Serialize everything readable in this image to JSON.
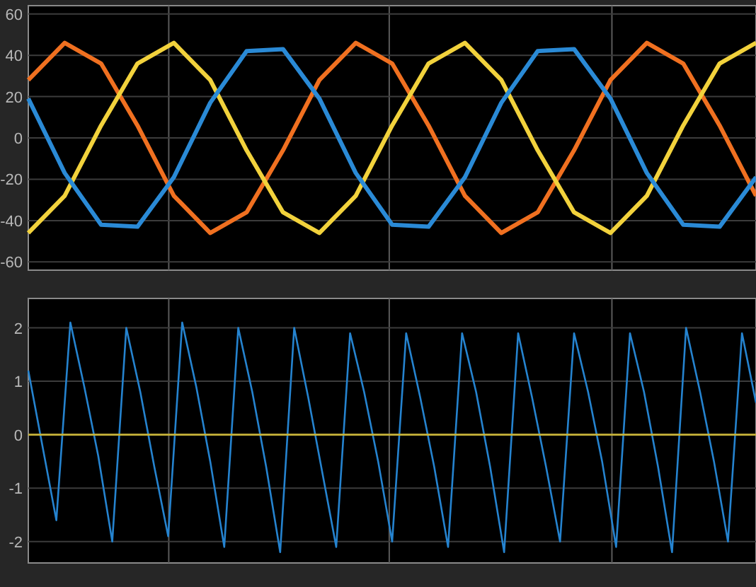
{
  "top_plot": {
    "chart_data": {
      "type": "line",
      "grid": true,
      "ylim": [
        -64,
        64
      ],
      "yticks": [
        -60,
        -40,
        -20,
        0,
        20,
        40,
        60
      ],
      "series": [
        {
          "color": "#f07020",
          "values": [
            28,
            46,
            36,
            6,
            -28,
            -46,
            -36,
            -6,
            28,
            46,
            36,
            6,
            -28,
            -46,
            -36,
            -6,
            28,
            46,
            36,
            6,
            -28
          ]
        },
        {
          "color": "#f2d23c",
          "values": [
            -46,
            -28,
            6,
            36,
            46,
            28,
            -6,
            -36,
            -46,
            -28,
            6,
            36,
            46,
            28,
            -6,
            -36,
            -46,
            -28,
            6,
            36,
            46
          ]
        },
        {
          "color": "#2a8ad6",
          "values": [
            19,
            -17,
            -42,
            -43,
            -19,
            17,
            42,
            43,
            19,
            -17,
            -42,
            -43,
            -19,
            17,
            42,
            43,
            19,
            -17,
            -42,
            -43,
            -19
          ]
        }
      ]
    }
  },
  "bottom_plot": {
    "chart_data": {
      "type": "line",
      "grid": true,
      "ylim": [
        -2.4,
        2.55
      ],
      "yticks": [
        -2,
        -1,
        0,
        1,
        2
      ],
      "series": [
        {
          "color": "#2583cf",
          "values": [
            1.2,
            -0.2,
            -1.6,
            2.1,
            0.9,
            -0.4,
            -2.0,
            2.0,
            0.8,
            -0.6,
            -1.9,
            2.1,
            0.9,
            -0.5,
            -2.1,
            2.0,
            0.8,
            -0.6,
            -2.2,
            2.0,
            0.7,
            -0.7,
            -2.1,
            1.9,
            0.8,
            -0.5,
            -2.0,
            1.9,
            0.7,
            -0.6,
            -2.1,
            1.9,
            0.8,
            -0.6,
            -2.2,
            1.9,
            0.7,
            -0.6,
            -2.0,
            1.9,
            0.8,
            -0.5,
            -2.1,
            1.9,
            0.8,
            -0.6,
            -2.2,
            2.0,
            0.8,
            -0.5,
            -2.0,
            1.9,
            0.6
          ]
        },
        {
          "color": "#c8b43a",
          "values": [
            0,
            0,
            0,
            0,
            0,
            0,
            0,
            0,
            0,
            0,
            0,
            0,
            0,
            0,
            0,
            0,
            0,
            0,
            0,
            0,
            0,
            0,
            0,
            0,
            0,
            0,
            0,
            0,
            0,
            0,
            0,
            0,
            0,
            0,
            0,
            0,
            0,
            0,
            0,
            0,
            0,
            0,
            0,
            0,
            0,
            0,
            0,
            0,
            0,
            0,
            0,
            0,
            0
          ]
        }
      ]
    }
  }
}
